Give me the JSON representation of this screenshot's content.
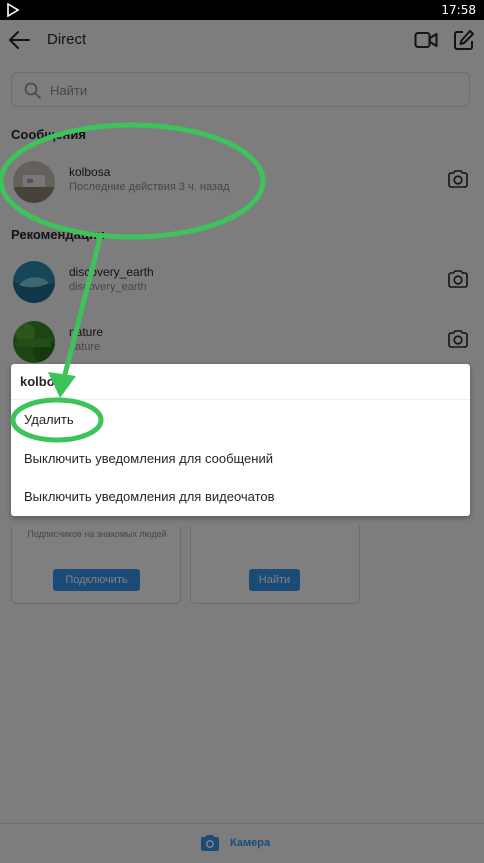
{
  "status_bar": {
    "time": "17:58"
  },
  "header": {
    "title": "Direct"
  },
  "search": {
    "placeholder": "Найти"
  },
  "messages_section": {
    "heading": "Сообщения"
  },
  "threads": [
    {
      "username": "kolbosa",
      "activity": "Последние действия 3 ч. назад"
    }
  ],
  "recommendations_section": {
    "heading": "Рекомендации"
  },
  "recommendations": [
    {
      "username": "discovery_earth",
      "subtitle": "discovery_earth"
    },
    {
      "username": "nature",
      "subtitle": "nature"
    }
  ],
  "cards": [
    {
      "description": "Подписчиков на знакомых людей",
      "button": "Подключить"
    },
    {
      "description": "",
      "button": "Найти"
    }
  ],
  "context_menu": {
    "title": "kolbosa",
    "items": [
      {
        "label": "Удалить"
      },
      {
        "label": "Выключить уведомления для сообщений"
      },
      {
        "label": "Выключить уведомления для видеочатов"
      }
    ]
  },
  "bottom_bar": {
    "camera_label": "Камера"
  },
  "colors": {
    "accent": "#3897f0",
    "annotation": "#3cc45a",
    "scrim": "rgba(0,0,0,0.5)"
  },
  "icons": [
    "play-icon",
    "back-arrow-icon",
    "video-camera-icon",
    "compose-icon",
    "search-icon",
    "camera-icon"
  ]
}
